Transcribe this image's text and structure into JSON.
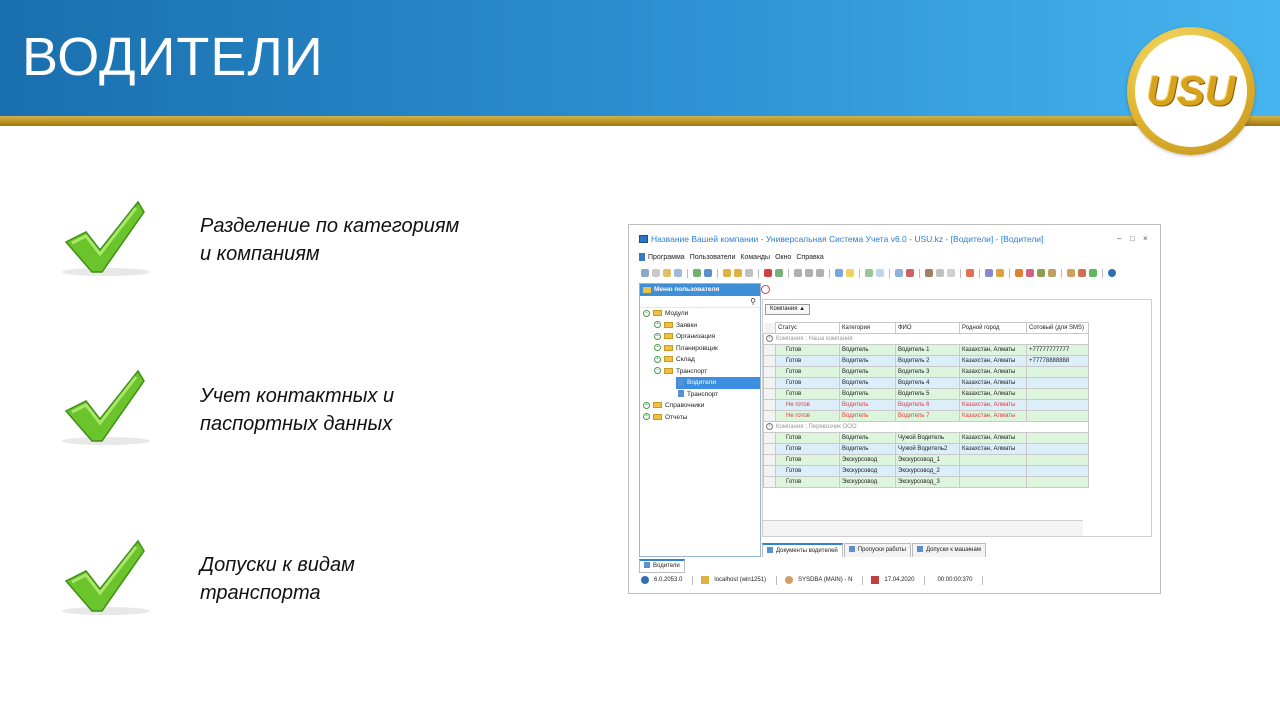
{
  "slide": {
    "title": "ВОДИТЕЛИ",
    "logo_text": "USU",
    "bullets": [
      {
        "line1": "Разделение по категориям",
        "line2": "и компаниям"
      },
      {
        "line1": "Учет контактных и",
        "line2": "паспортных данных"
      },
      {
        "line1": "Допуски к видам",
        "line2": "транспорта"
      }
    ]
  },
  "window": {
    "title": "Название Вашей компании - Универсальная Система Учета v6.0 - USU.kz - [Водители] - [Водители]",
    "controls": [
      "–",
      "□",
      "×"
    ],
    "menu": [
      "Программа",
      "Пользователи",
      "Команды",
      "Окно",
      "Справка"
    ]
  },
  "sidebar": {
    "header": "Меню пользователя",
    "items": [
      {
        "label": "Модули"
      },
      {
        "label": "Заявки"
      },
      {
        "label": "Организация"
      },
      {
        "label": "Планировщик"
      },
      {
        "label": "Склад"
      },
      {
        "label": "Транспорт"
      },
      {
        "label": "Водители"
      },
      {
        "label": "Транспорт"
      },
      {
        "label": "Справочники"
      },
      {
        "label": "Отчеты"
      }
    ]
  },
  "grid": {
    "group_by": "Компания",
    "columns": [
      "Статус",
      "Категория",
      "ФИО",
      "Родной город",
      "Сотовый (для SMS)"
    ],
    "group1": "Компания : Наша компания",
    "group2": "Компания : Перевозчик ООО",
    "rows1": [
      [
        "Готов",
        "Водитель",
        "Водитель 1",
        "Казахстан, Алматы",
        "+77777777777"
      ],
      [
        "Готов",
        "Водитель",
        "Водитель 2",
        "Казахстан, Алматы",
        "+77778888888"
      ],
      [
        "Готов",
        "Водитель",
        "Водитель 3",
        "Казахстан, Алматы",
        ""
      ],
      [
        "Готов",
        "Водитель",
        "Водитель 4",
        "Казахстан, Алматы",
        ""
      ],
      [
        "Готов",
        "Водитель",
        "Водитель 5",
        "Казахстан, Алматы",
        ""
      ],
      [
        "Не готов",
        "Водитель",
        "Водитель 6",
        "Казахстан, Алматы",
        ""
      ],
      [
        "Не готов",
        "Водитель",
        "Водитель 7",
        "Казахстан, Алматы",
        ""
      ]
    ],
    "rows2": [
      [
        "Готов",
        "Водитель",
        "Чужой Водитель",
        "Казахстан, Алматы",
        ""
      ],
      [
        "Готов",
        "Водитель",
        "Чужой Водитель2",
        "Казахстан, Алматы",
        ""
      ],
      [
        "Готов",
        "Экскурсовод",
        "Экскурсовод_1",
        "",
        ""
      ],
      [
        "Готов",
        "Экскурсовод",
        "Экскурсовод_2",
        "",
        ""
      ],
      [
        "Готов",
        "Экскурсовод",
        "Экскурсовод_3",
        "",
        ""
      ]
    ]
  },
  "bottom_tabs": [
    "Документы водителей",
    "Пропуски работы",
    "Допуски к машинам"
  ],
  "mdi_tab": "Водители",
  "status": {
    "version": "6.0.2053.0",
    "server": "localhost (win1251)",
    "user": "SYSDBA (MAIN) - N",
    "date": "17.04.2020",
    "time": "00:00:00:370"
  },
  "colors": {
    "ready_green": "#ddf5dd",
    "alt_blue": "#dbeefa",
    "not_ready_red": "#e23a3a",
    "accent": "#2f82d0"
  }
}
